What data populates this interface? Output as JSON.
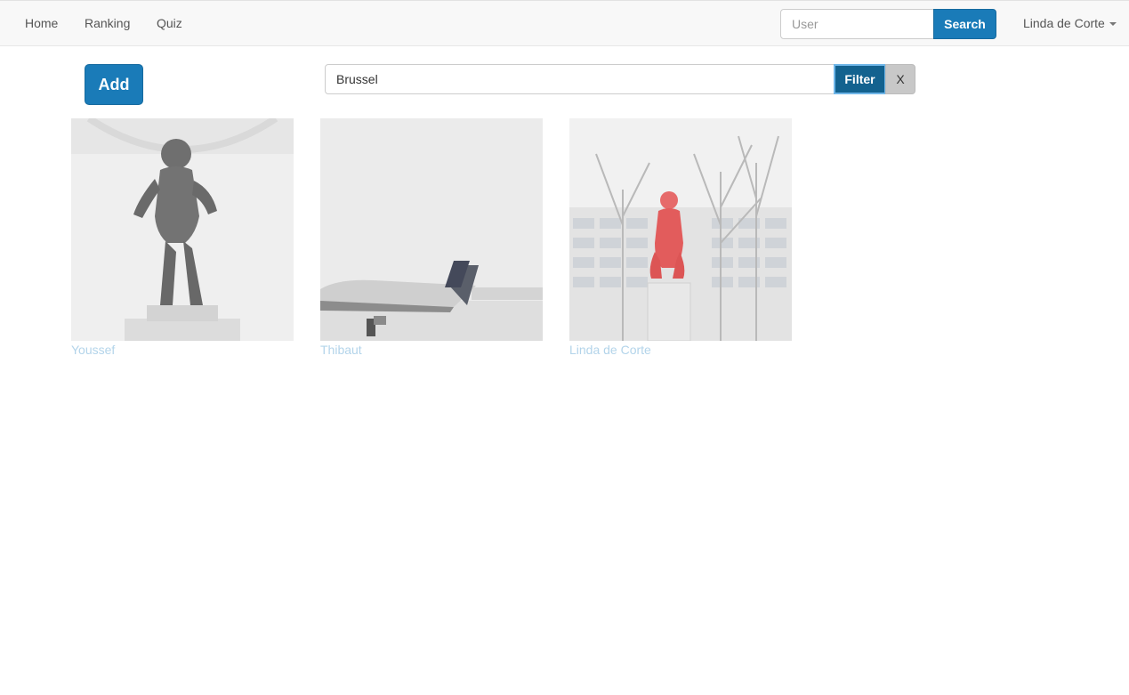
{
  "nav": {
    "links": [
      {
        "label": "Home"
      },
      {
        "label": "Ranking"
      },
      {
        "label": "Quiz"
      }
    ],
    "user_search": {
      "placeholder": "User",
      "value": "",
      "button_label": "Search"
    },
    "user_menu": {
      "label": "Linda de Corte"
    }
  },
  "toolbar": {
    "add_label": "Add",
    "filter": {
      "value": "Brussel",
      "button_label": "Filter",
      "clear_label": "X"
    }
  },
  "gallery": {
    "items": [
      {
        "author": "Youssef",
        "image": "statue-photo"
      },
      {
        "author": "Thibaut",
        "image": "airplane-photo"
      },
      {
        "author": "Linda de Corte",
        "image": "red-statue-photo"
      }
    ]
  },
  "colors": {
    "accent": "#1a7bb8",
    "link_faded": "#b3d4ea"
  }
}
